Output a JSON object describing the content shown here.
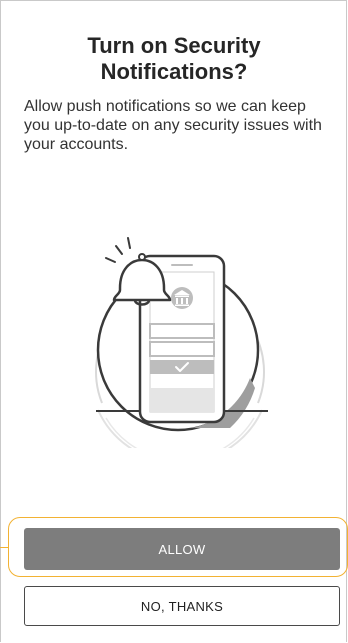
{
  "dialog": {
    "title": "Turn on Security Notifications?",
    "message": "Allow push notifications so we can keep you up-to-date on any security issues with your accounts."
  },
  "illustration": {
    "icons": [
      "bell-icon",
      "phone-icon",
      "bank-icon",
      "checkmark-icon"
    ]
  },
  "actions": {
    "allow_label": "ALLOW",
    "no_thanks_label": "NO, THANKS"
  },
  "colors": {
    "primary_button": "#7d7d7d",
    "highlight": "#f2b233",
    "text": "#262626"
  }
}
